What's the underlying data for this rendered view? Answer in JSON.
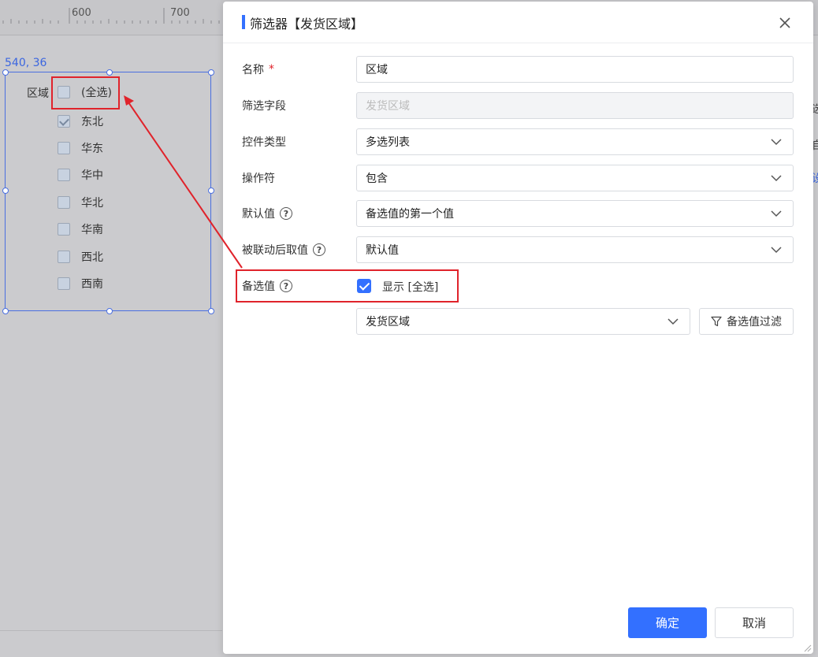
{
  "ruler": {
    "labels": [
      "600",
      "700"
    ]
  },
  "canvas": {
    "coord_readout": "540, 36",
    "widget": {
      "label": "区域",
      "items": [
        {
          "label": "(全选)",
          "checked": false
        },
        {
          "label": "东北",
          "checked": true
        },
        {
          "label": "华东",
          "checked": false
        },
        {
          "label": "华中",
          "checked": false
        },
        {
          "label": "华北",
          "checked": false
        },
        {
          "label": "华南",
          "checked": false
        },
        {
          "label": "西北",
          "checked": false
        },
        {
          "label": "西南",
          "checked": false
        }
      ]
    }
  },
  "dialog": {
    "title": "筛选器【发货区域】",
    "fields": {
      "name": {
        "label": "名称",
        "required_mark": "*",
        "value": "区域"
      },
      "filter_field": {
        "label": "筛选字段",
        "value": "发货区域"
      },
      "control_type": {
        "label": "控件类型",
        "value": "多选列表"
      },
      "operator": {
        "label": "操作符",
        "value": "包含"
      },
      "default_value": {
        "label": "默认值",
        "help": "?",
        "value": "备选值的第一个值"
      },
      "linked_value": {
        "label": "被联动后取值",
        "help": "?",
        "value": "默认值"
      },
      "options": {
        "label": "备选值",
        "help": "?",
        "show_all_label": "显示 [全选]",
        "show_all_checked": true,
        "source_value": "发货区域",
        "filter_button": "备选值过滤"
      }
    },
    "ok_button": "确定",
    "cancel_button": "取消"
  },
  "colors": {
    "accent": "#3370ff",
    "highlight": "#e0232b"
  }
}
